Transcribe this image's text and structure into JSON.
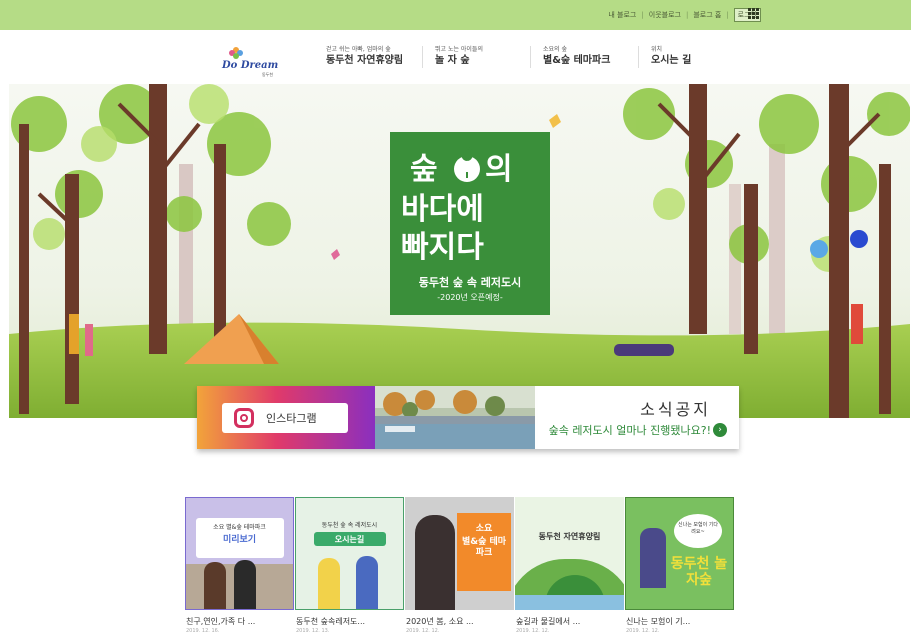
{
  "topbar": {
    "links": [
      "내 블로그",
      "이웃블로그",
      "블로그 홈"
    ],
    "login_label": "로그인",
    "bg_color": "#b5dc86"
  },
  "logo": {
    "brand": "Do Dream",
    "sub": "동두천"
  },
  "gnb": [
    {
      "small": "걷고 쉬는 아빠, 엄마의 숲",
      "big": "동두천 자연휴양림"
    },
    {
      "small": "뛰고 노는 아이들의",
      "big": "놀 자 숲"
    },
    {
      "small": "소요의 숲",
      "big": "별&숲 테마파크"
    },
    {
      "small": "위치",
      "big": "오시는 길"
    }
  ],
  "hero": {
    "title_line1_a": "숲",
    "title_line1_b": "의",
    "title_line2": "바다에",
    "title_line3": "빠지다",
    "subtitle": "동두천 숲 속 레저도시",
    "note": "-2020년 오픈예정-",
    "accent_color": "#3a8f3a"
  },
  "promo": {
    "instagram_label": "인스타그램",
    "notice_title": "소식공지",
    "notice_text": "숲속 레저도시 얼마나 진행됐나요?!",
    "arrow_icon": "chevron-right-icon"
  },
  "posts": [
    {
      "title": "친구,연인,가족 다 ...",
      "date": "2019. 12. 16.",
      "img_top": "소요 별&숲 테마파크",
      "img_main": "미리보기"
    },
    {
      "title": "동두천 숲속레저도...",
      "date": "2019. 12. 13.",
      "img_top": "동두천 숲 속 레저도시",
      "img_main": "오시는길"
    },
    {
      "title": "2020년 봄, 소요 ...",
      "date": "2019. 12. 12.",
      "img_top": "소요",
      "img_main": "별&숲 테마파크"
    },
    {
      "title": "숲길과 물길에서 ...",
      "date": "2019. 12. 12.",
      "img_top": "",
      "img_main": "동두천 자연휴양림"
    },
    {
      "title": "신나는 모험이 기...",
      "date": "2019. 12. 12.",
      "img_top": "신나는 모험이 기다려요~",
      "img_main": "동두천 놀자숲"
    }
  ]
}
